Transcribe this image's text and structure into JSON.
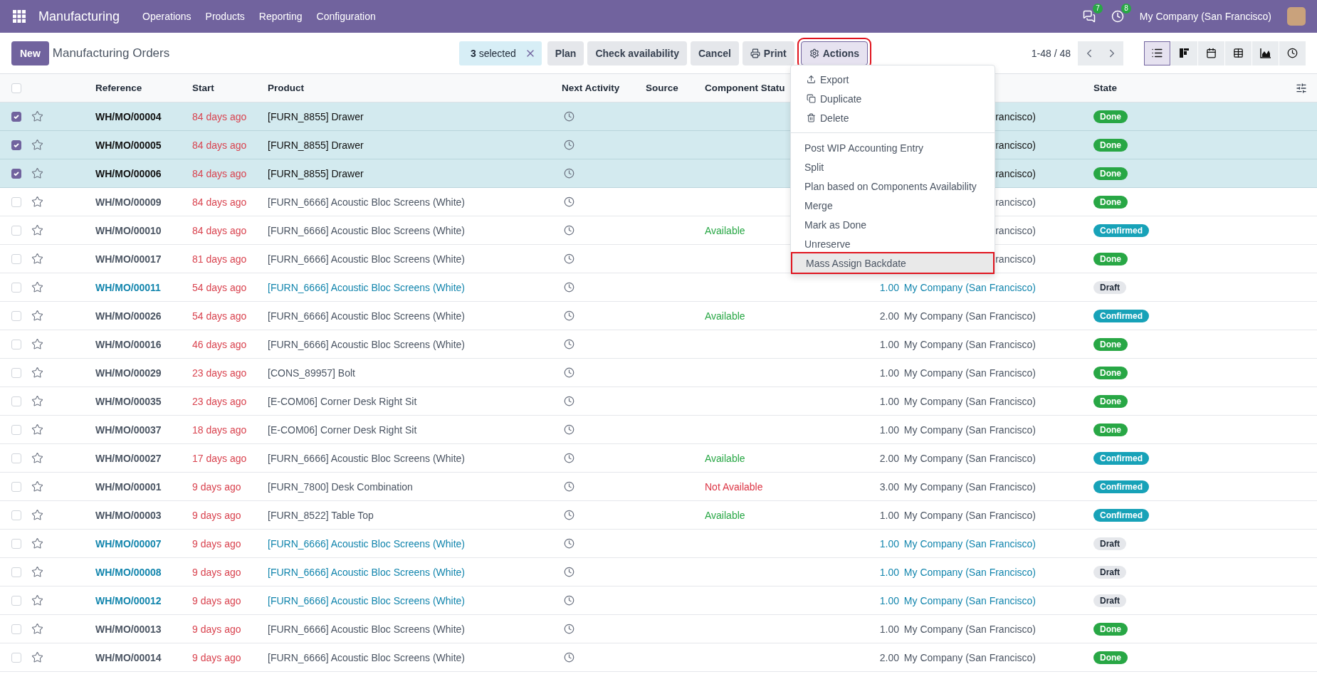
{
  "navbar": {
    "app_name": "Manufacturing",
    "menu": [
      "Operations",
      "Products",
      "Reporting",
      "Configuration"
    ],
    "messages_count": "7",
    "activities_count": "8",
    "company": "My Company (San Francisco)"
  },
  "control_panel": {
    "new_button": "New",
    "title": "Manufacturing Orders",
    "selection": "**3** selected",
    "buttons": [
      "Plan",
      "Check availability",
      "Cancel"
    ],
    "print": "Print",
    "actions": {
      "label": "Actions",
      "selected": true
    },
    "pager": "1-48 / 48",
    "views": [
      {
        "selected": true
      },
      {
        "selected": false
      },
      {
        "selected": false
      },
      {
        "selected": false
      },
      {
        "selected": false
      },
      {
        "selected": false
      }
    ]
  },
  "actions_menu": {
    "sections": [
      {
        "items": [
          {
            "label": "Export",
            "selected": false
          },
          {
            "label": "Duplicate",
            "selected": false
          },
          {
            "label": "Delete",
            "selected": false
          }
        ]
      },
      {
        "items": [
          {
            "label": "Post WIP Accounting Entry",
            "selected": false
          },
          {
            "label": "Split",
            "selected": false
          },
          {
            "label": "Plan based on Components Availability",
            "selected": false
          },
          {
            "label": "Merge",
            "selected": false
          },
          {
            "label": "Mark as Done",
            "selected": false
          },
          {
            "label": "Unreserve",
            "selected": false
          },
          {
            "label": "Mass Assign Backdate",
            "selected": true
          }
        ]
      }
    ]
  },
  "table": {
    "all_selected": false,
    "columns": [
      "Reference",
      "Start",
      "Product",
      "Next Activity",
      "Source",
      "Component Statu",
      "State"
    ],
    "rows": [
      {
        "selected": true,
        "reference": "WH/MO/00004",
        "start": "84 days ago",
        "product": "[FURN_8855] Drawer",
        "company": "rancisco)",
        "state": {
          "label": "Done",
          "kind": "done"
        }
      },
      {
        "selected": true,
        "reference": "WH/MO/00005",
        "start": "84 days ago",
        "product": "[FURN_8855] Drawer",
        "company": "rancisco)",
        "state": {
          "label": "Done",
          "kind": "done"
        }
      },
      {
        "selected": true,
        "reference": "WH/MO/00006",
        "start": "84 days ago",
        "product": "[FURN_8855] Drawer",
        "company": "rancisco)",
        "state": {
          "label": "Done",
          "kind": "done"
        }
      },
      {
        "selected": false,
        "reference": "WH/MO/00009",
        "start": "84 days ago",
        "product": "[FURN_6666] Acoustic Bloc Screens (White)",
        "company": "rancisco)",
        "state": {
          "label": "Done",
          "kind": "done"
        }
      },
      {
        "selected": false,
        "reference": "WH/MO/00010",
        "start": "84 days ago",
        "product": "[FURN_6666] Acoustic Bloc Screens (White)",
        "component_status": {
          "label": "Available",
          "kind": "available"
        },
        "company": "rancisco)",
        "state": {
          "label": "Confirmed",
          "kind": "confirmed"
        }
      },
      {
        "selected": false,
        "reference": "WH/MO/00017",
        "start": "81 days ago",
        "product": "[FURN_6666] Acoustic Bloc Screens (White)",
        "company": "rancisco)",
        "state": {
          "label": "Done",
          "kind": "done"
        }
      },
      {
        "selected": false,
        "reference": "WH/MO/00011",
        "start": "54 days ago",
        "product": "[FURN_6666] Acoustic Bloc Screens (White)",
        "quantity": "1.00",
        "company": "My Company (San Francisco)",
        "state": {
          "label": "Draft",
          "kind": "draft"
        }
      },
      {
        "selected": false,
        "reference": "WH/MO/00026",
        "start": "54 days ago",
        "product": "[FURN_6666] Acoustic Bloc Screens (White)",
        "component_status": {
          "label": "Available",
          "kind": "available"
        },
        "quantity": "2.00",
        "company": "My Company (San Francisco)",
        "state": {
          "label": "Confirmed",
          "kind": "confirmed"
        }
      },
      {
        "selected": false,
        "reference": "WH/MO/00016",
        "start": "46 days ago",
        "product": "[FURN_6666] Acoustic Bloc Screens (White)",
        "quantity": "1.00",
        "company": "My Company (San Francisco)",
        "state": {
          "label": "Done",
          "kind": "done"
        }
      },
      {
        "selected": false,
        "reference": "WH/MO/00029",
        "start": "23 days ago",
        "product": "[CONS_89957] Bolt",
        "quantity": "1.00",
        "company": "My Company (San Francisco)",
        "state": {
          "label": "Done",
          "kind": "done"
        }
      },
      {
        "selected": false,
        "reference": "WH/MO/00035",
        "start": "23 days ago",
        "product": "[E-COM06] Corner Desk Right Sit",
        "quantity": "1.00",
        "company": "My Company (San Francisco)",
        "state": {
          "label": "Done",
          "kind": "done"
        }
      },
      {
        "selected": false,
        "reference": "WH/MO/00037",
        "start": "18 days ago",
        "product": "[E-COM06] Corner Desk Right Sit",
        "quantity": "1.00",
        "company": "My Company (San Francisco)",
        "state": {
          "label": "Done",
          "kind": "done"
        }
      },
      {
        "selected": false,
        "reference": "WH/MO/00027",
        "start": "17 days ago",
        "product": "[FURN_6666] Acoustic Bloc Screens (White)",
        "component_status": {
          "label": "Available",
          "kind": "available"
        },
        "quantity": "2.00",
        "company": "My Company (San Francisco)",
        "state": {
          "label": "Confirmed",
          "kind": "confirmed"
        }
      },
      {
        "selected": false,
        "reference": "WH/MO/00001",
        "start": "9 days ago",
        "product": "[FURN_7800] Desk Combination",
        "component_status": {
          "label": "Not Available",
          "kind": "not_available"
        },
        "quantity": "3.00",
        "company": "My Company (San Francisco)",
        "state": {
          "label": "Confirmed",
          "kind": "confirmed"
        }
      },
      {
        "selected": false,
        "reference": "WH/MO/00003",
        "start": "9 days ago",
        "product": "[FURN_8522] Table Top",
        "component_status": {
          "label": "Available",
          "kind": "available"
        },
        "quantity": "1.00",
        "company": "My Company (San Francisco)",
        "state": {
          "label": "Confirmed",
          "kind": "confirmed"
        }
      },
      {
        "selected": false,
        "reference": "WH/MO/00007",
        "start": "9 days ago",
        "product": "[FURN_6666] Acoustic Bloc Screens (White)",
        "quantity": "1.00",
        "company": "My Company (San Francisco)",
        "state": {
          "label": "Draft",
          "kind": "draft"
        }
      },
      {
        "selected": false,
        "reference": "WH/MO/00008",
        "start": "9 days ago",
        "product": "[FURN_6666] Acoustic Bloc Screens (White)",
        "quantity": "1.00",
        "company": "My Company (San Francisco)",
        "state": {
          "label": "Draft",
          "kind": "draft"
        }
      },
      {
        "selected": false,
        "reference": "WH/MO/00012",
        "start": "9 days ago",
        "product": "[FURN_6666] Acoustic Bloc Screens (White)",
        "quantity": "1.00",
        "company": "My Company (San Francisco)",
        "state": {
          "label": "Draft",
          "kind": "draft"
        }
      },
      {
        "selected": false,
        "reference": "WH/MO/00013",
        "start": "9 days ago",
        "product": "[FURN_6666] Acoustic Bloc Screens (White)",
        "quantity": "1.00",
        "company": "My Company (San Francisco)",
        "state": {
          "label": "Done",
          "kind": "done"
        }
      },
      {
        "selected": false,
        "reference": "WH/MO/00014",
        "start": "9 days ago",
        "product": "[FURN_6666] Acoustic Bloc Screens (White)",
        "quantity": "2.00",
        "company": "My Company (San Francisco)",
        "state": {
          "label": "Done",
          "kind": "done"
        }
      }
    ]
  }
}
